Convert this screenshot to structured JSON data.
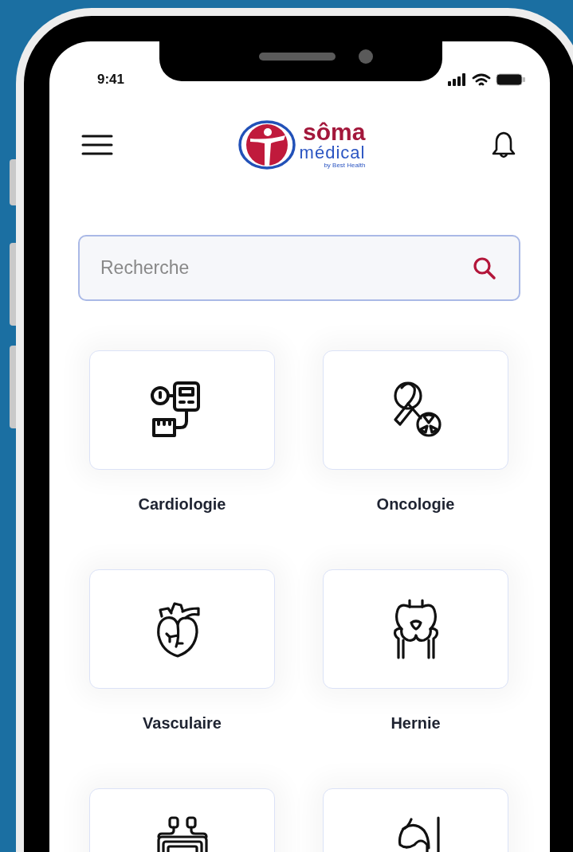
{
  "status_bar": {
    "time": "9:41"
  },
  "header": {
    "logo": {
      "name": "sôma",
      "subtitle": "médical",
      "tagline": "by Best Health"
    }
  },
  "search": {
    "placeholder": "Recherche"
  },
  "categories": [
    {
      "kind": "labeled",
      "label": "Cardiologie"
    },
    {
      "kind": "labeled",
      "label": "Oncologie"
    },
    {
      "kind": "labeled",
      "label": "Vasculaire"
    },
    {
      "kind": "labeled",
      "label": "Hernie"
    },
    {
      "kind": "cut"
    },
    {
      "kind": "cut"
    }
  ]
}
